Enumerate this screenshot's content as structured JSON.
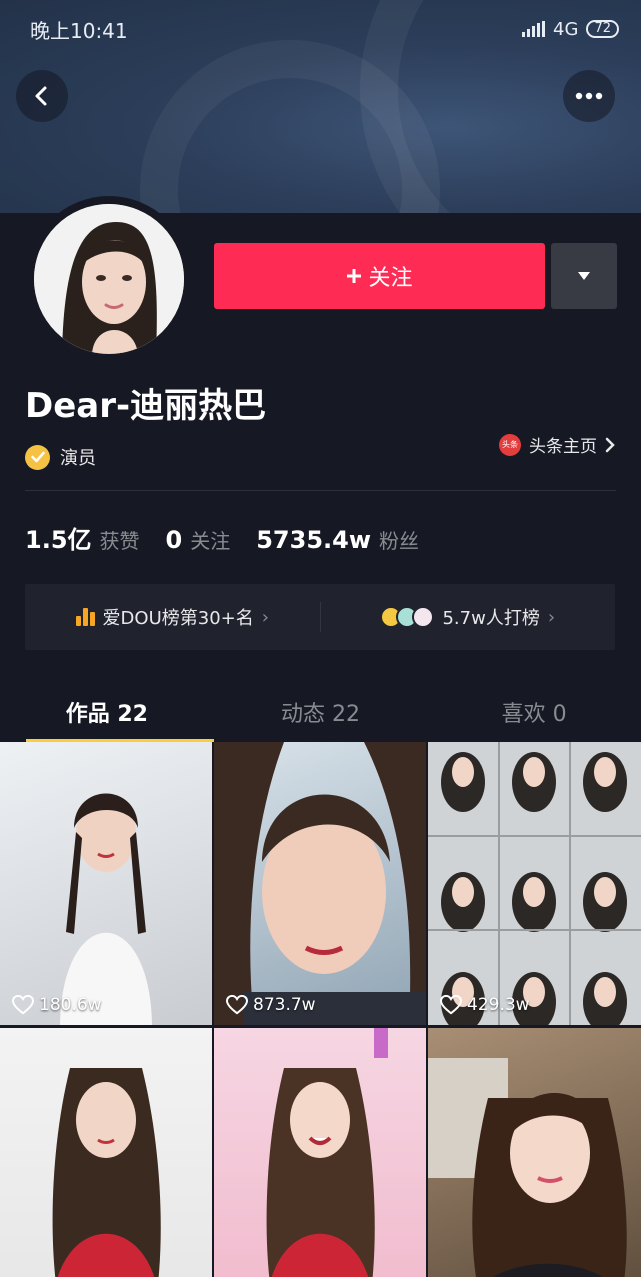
{
  "status_bar": {
    "time": "晚上10:41",
    "network": "4G",
    "battery": "72"
  },
  "profile": {
    "name": "Dear-迪丽热巴",
    "badge": "演员",
    "toutiao_logo": "头条",
    "toutiao_link": "头条主页",
    "follow_label": "关注"
  },
  "stats": [
    {
      "value": "1.5亿",
      "label": "获赞"
    },
    {
      "value": "0",
      "label": "关注"
    },
    {
      "value": "5735.4w",
      "label": "粉丝"
    }
  ],
  "rank": {
    "left": "爱DOU榜第30+名",
    "right": "5.7w人打榜"
  },
  "tabs": [
    {
      "label": "作品 22",
      "active": true
    },
    {
      "label": "动态 22",
      "active": false
    },
    {
      "label": "喜欢 0",
      "active": false
    }
  ],
  "videos": [
    {
      "likes": "180.6w"
    },
    {
      "likes": "873.7w"
    },
    {
      "likes": "429.3w"
    },
    {
      "likes": ""
    },
    {
      "likes": ""
    },
    {
      "likes": ""
    }
  ],
  "colors": {
    "accent": "#fe2c55",
    "tab_indicator": "#facd3e",
    "background": "#161823"
  },
  "icons": [
    "back-icon",
    "more-icon",
    "plus-icon",
    "caret-down-icon",
    "verified-icon",
    "chevron-right-icon",
    "chart-bars-icon",
    "heart-icon"
  ]
}
